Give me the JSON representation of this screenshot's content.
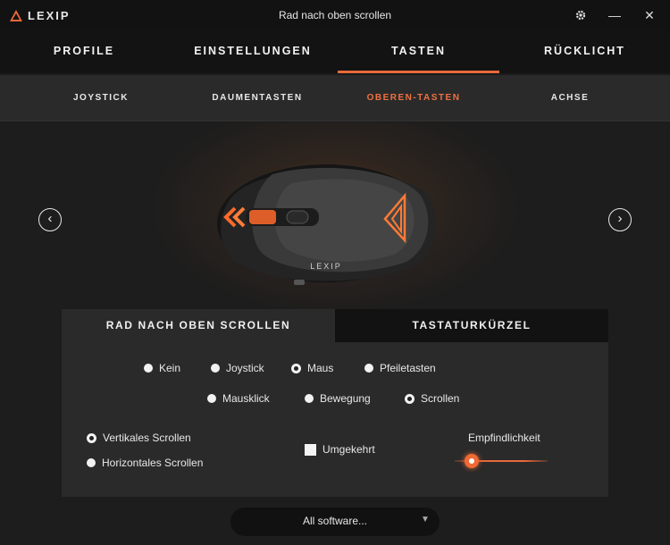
{
  "app": {
    "logo_text": "LEXIP",
    "window_title": "Rad nach oben scrollen",
    "settings_icon": "gear-icon",
    "minimize_glyph": "—",
    "close_glyph": "✕"
  },
  "colors": {
    "accent": "#e8683a",
    "background": "#1a1a1a",
    "panel": "#2a2a2a"
  },
  "main_tabs": [
    {
      "label": "PROFILE"
    },
    {
      "label": "EINSTELLUNGEN"
    },
    {
      "label": "TASTEN",
      "active": true
    },
    {
      "label": "RÜCKLICHT"
    }
  ],
  "sub_tabs": [
    {
      "label": "JOYSTICK"
    },
    {
      "label": "DAUMENTASTEN"
    },
    {
      "label": "OBEREN-TASTEN",
      "active": true
    },
    {
      "label": "ACHSE"
    }
  ],
  "nav": {
    "prev_glyph": "‹",
    "next_glyph": "›"
  },
  "mouse_image": {
    "brand_on_device": "LEXIP"
  },
  "panel": {
    "tabs": [
      {
        "label": "RAD NACH OBEN SCROLLEN",
        "active": true
      },
      {
        "label": "TASTATURKÜRZEL"
      }
    ],
    "type_options": [
      {
        "label": "Kein",
        "selected": false
      },
      {
        "label": "Joystick",
        "selected": false
      },
      {
        "label": "Maus",
        "selected": true
      },
      {
        "label": "Pfeiletasten",
        "selected": false
      }
    ],
    "mouse_options": [
      {
        "label": "Mausklick",
        "selected": false
      },
      {
        "label": "Bewegung",
        "selected": false
      },
      {
        "label": "Scrollen",
        "selected": true
      }
    ],
    "scroll_options": [
      {
        "label": "Vertikales Scrollen",
        "selected": true
      },
      {
        "label": "Horizontales Scrollen",
        "selected": false
      }
    ],
    "inverted": {
      "label": "Umgekehrt",
      "checked": false
    },
    "sensitivity": {
      "label": "Empfindlichkeit",
      "value_fraction": 0.18
    }
  },
  "software_select": {
    "value": "All software...",
    "chevron_icon": "chevron-down-icon"
  }
}
